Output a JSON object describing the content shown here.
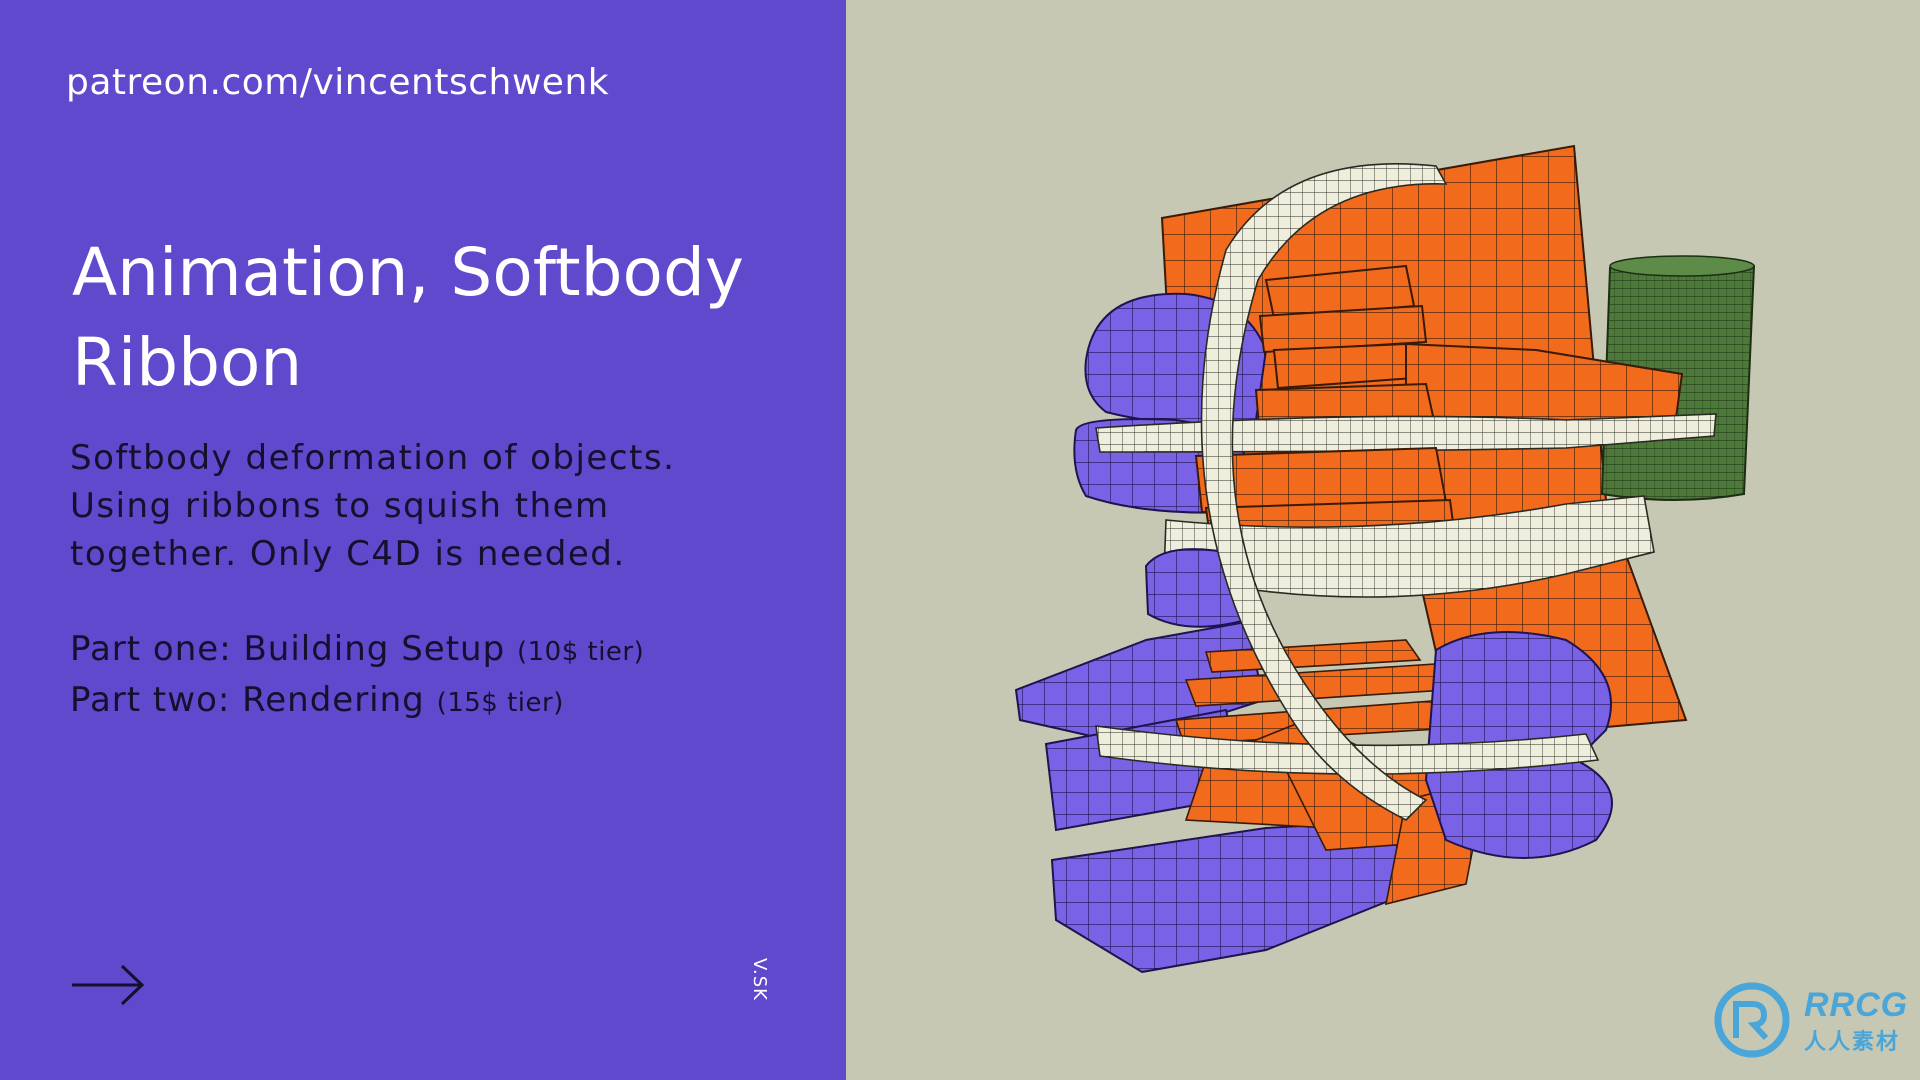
{
  "slide": {
    "url": "patreon.com/vincentschwenk",
    "title_line1": "Animation, Softbody",
    "title_line2": "Ribbon",
    "description": [
      "Softbody deformation of objects.",
      "Using ribbons to squish them",
      "together. Only C4D is needed."
    ],
    "parts": [
      {
        "label": "Part one: Building Setup",
        "tier": "(10$ tier)"
      },
      {
        "label": "Part two: Rendering",
        "tier": "(15$ tier)"
      }
    ],
    "side_mark": "V.SK",
    "arrow_icon": "arrow-right-icon"
  },
  "watermark": {
    "logo_icon": "rrcg-logo-icon",
    "text": "RRCG",
    "subtext": "人人素材"
  },
  "colors": {
    "panel_purple": "#6049cc",
    "background": "#c6c8b4",
    "orange": "#f26a1c",
    "violet": "#7a62e6",
    "ribbon": "#efeedd",
    "green": "#4d7a3a"
  }
}
